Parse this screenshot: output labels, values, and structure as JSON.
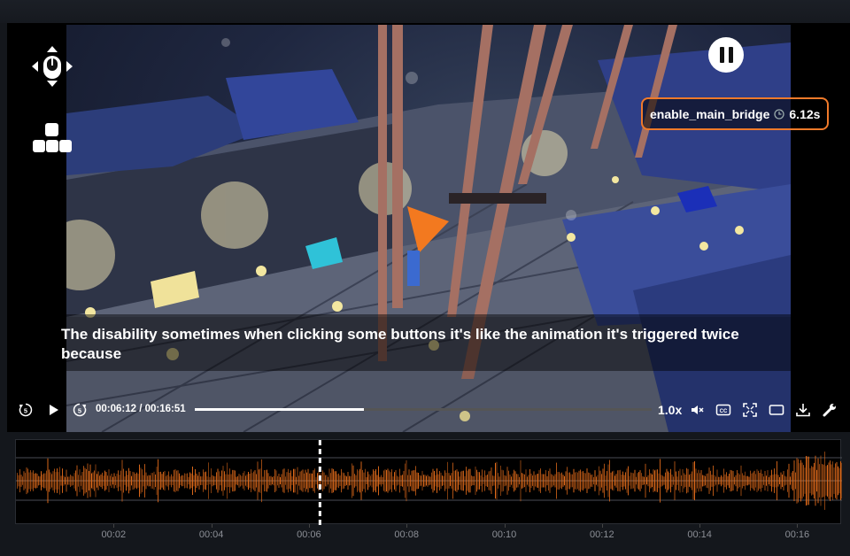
{
  "video": {
    "subtitle": "The disability sometimes when clicking some buttons it's like the animation it's triggered twice because",
    "event_tag": {
      "name": "enable_main_bridge",
      "duration": "6.12s"
    }
  },
  "overlay_icons": [
    "mouse-move-icon",
    "blocks-icon"
  ],
  "playback": {
    "current_time": "00:06:12",
    "total_time": "00:16:51",
    "time_display": "00:06:12 / 00:16:51",
    "progress": 0.37,
    "speed": "1.0x",
    "state": "playing"
  },
  "control_icons": [
    "rewind-5-icon",
    "play-icon",
    "forward-5-icon",
    "mute-icon",
    "captions-icon",
    "fullscreen-icon",
    "theater-mode-icon",
    "download-icon",
    "settings-wrench-icon"
  ],
  "timeline": {
    "waveform_color": "#e06a1a",
    "playhead_position": 0.368,
    "ticks": [
      "00:02",
      "00:04",
      "00:06",
      "00:08",
      "00:10",
      "00:12",
      "00:14",
      "00:16"
    ]
  },
  "colors": {
    "accent": "#f07a2a",
    "background": "#14171c"
  }
}
